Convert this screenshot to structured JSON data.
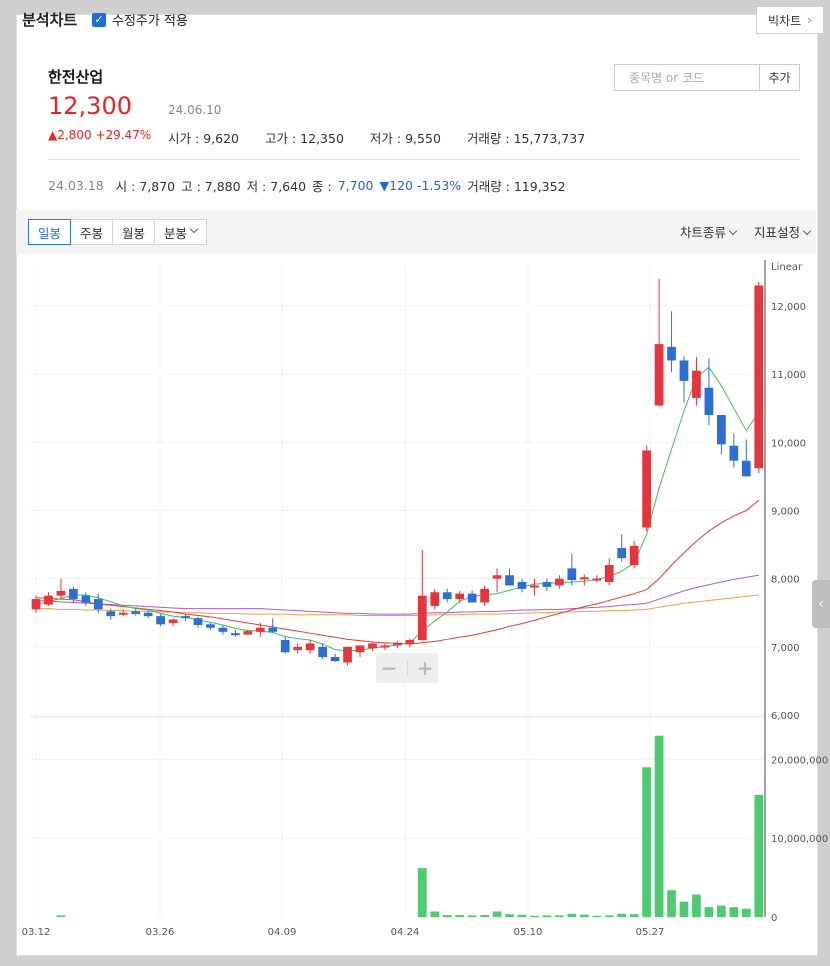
{
  "header": {
    "title": "분석차트",
    "adjusted_label": "수정주가 적용",
    "adjusted_checked": true,
    "big_chart_label": "빅차트"
  },
  "stock": {
    "name": "한전산업",
    "price": "12,300",
    "date": "24.06.10",
    "change": "▲2,800 +29.47%",
    "ohlc": [
      {
        "label": "시가",
        "value": "9,620"
      },
      {
        "label": "고가",
        "value": "12,350"
      },
      {
        "label": "저가",
        "value": "9,550"
      },
      {
        "label": "거래량",
        "value": "15,773,737"
      }
    ]
  },
  "search": {
    "placeholder": "종목명 or 코드",
    "add_label": "추가"
  },
  "previous": {
    "date": "24.03.18",
    "open": "시 : 7,870",
    "high": "고 : 7,880",
    "low": "저 : 7,640",
    "close_label": "종 :",
    "close_value": "7,700",
    "change": "▼120 -1.53%",
    "volume": "거래량 : 119,352"
  },
  "toolbar": {
    "tabs": [
      "일봉",
      "주봉",
      "월봉",
      "분봉"
    ],
    "active_tab": "일봉",
    "chart_type_label": "차트종류",
    "indicator_label": "지표설정"
  },
  "colors": {
    "up": "#e8343c",
    "down": "#2b6fd6",
    "volume": "#4ecb71",
    "ma5": "#3cc060",
    "ma20": "#e0403a",
    "ma60": "#a45de0",
    "ma120": "#f0a040"
  },
  "chart_data": {
    "type": "candlestick",
    "scale_label": "Linear",
    "price_axis": {
      "ylim": [
        6000,
        12600
      ],
      "ticks": [
        "12,000",
        "11,000",
        "10,000",
        "9,000",
        "8,000",
        "7,000",
        "6,000"
      ]
    },
    "volume_axis": {
      "ylim": [
        0,
        25000000
      ],
      "ticks": [
        "20,000,000",
        "10,000,000",
        "0"
      ]
    },
    "x_ticks": [
      "03.12",
      "03.26",
      "04.09",
      "04.24",
      "05.10",
      "05.27"
    ],
    "candles": [
      {
        "o": 7550,
        "h": 7750,
        "l": 7500,
        "c": 7700
      },
      {
        "o": 7620,
        "h": 7800,
        "l": 7600,
        "c": 7750
      },
      {
        "o": 7750,
        "h": 8000,
        "l": 7700,
        "c": 7820
      },
      {
        "o": 7850,
        "h": 7880,
        "l": 7640,
        "c": 7700
      },
      {
        "o": 7750,
        "h": 7800,
        "l": 7600,
        "c": 7650
      },
      {
        "o": 7700,
        "h": 7780,
        "l": 7500,
        "c": 7550
      },
      {
        "o": 7520,
        "h": 7560,
        "l": 7400,
        "c": 7450
      },
      {
        "o": 7480,
        "h": 7550,
        "l": 7450,
        "c": 7500
      },
      {
        "o": 7520,
        "h": 7560,
        "l": 7460,
        "c": 7480
      },
      {
        "o": 7500,
        "h": 7520,
        "l": 7420,
        "c": 7450
      },
      {
        "o": 7450,
        "h": 7480,
        "l": 7300,
        "c": 7330
      },
      {
        "o": 7350,
        "h": 7420,
        "l": 7300,
        "c": 7400
      },
      {
        "o": 7450,
        "h": 7480,
        "l": 7380,
        "c": 7420
      },
      {
        "o": 7420,
        "h": 7440,
        "l": 7280,
        "c": 7320
      },
      {
        "o": 7330,
        "h": 7350,
        "l": 7250,
        "c": 7280
      },
      {
        "o": 7280,
        "h": 7320,
        "l": 7180,
        "c": 7220
      },
      {
        "o": 7200,
        "h": 7250,
        "l": 7150,
        "c": 7180
      },
      {
        "o": 7180,
        "h": 7250,
        "l": 7170,
        "c": 7230
      },
      {
        "o": 7220,
        "h": 7350,
        "l": 7150,
        "c": 7280
      },
      {
        "o": 7280,
        "h": 7420,
        "l": 7200,
        "c": 7220
      },
      {
        "o": 7100,
        "h": 7150,
        "l": 6900,
        "c": 6920
      },
      {
        "o": 6950,
        "h": 7050,
        "l": 6900,
        "c": 7000
      },
      {
        "o": 6950,
        "h": 7100,
        "l": 6900,
        "c": 7050
      },
      {
        "o": 7000,
        "h": 7050,
        "l": 6820,
        "c": 6850
      },
      {
        "o": 6850,
        "h": 6900,
        "l": 6780,
        "c": 6790
      },
      {
        "o": 6770,
        "h": 7000,
        "l": 6730,
        "c": 7000
      },
      {
        "o": 6920,
        "h": 7000,
        "l": 6850,
        "c": 7020
      },
      {
        "o": 6980,
        "h": 7060,
        "l": 6940,
        "c": 7050
      },
      {
        "o": 7000,
        "h": 7050,
        "l": 6950,
        "c": 7020
      },
      {
        "o": 7020,
        "h": 7080,
        "l": 6980,
        "c": 7060
      },
      {
        "o": 7050,
        "h": 7120,
        "l": 7000,
        "c": 7100
      },
      {
        "o": 7100,
        "h": 8420,
        "l": 7080,
        "c": 7750
      },
      {
        "o": 7600,
        "h": 7850,
        "l": 7550,
        "c": 7800
      },
      {
        "o": 7800,
        "h": 7850,
        "l": 7650,
        "c": 7700
      },
      {
        "o": 7700,
        "h": 7820,
        "l": 7650,
        "c": 7780
      },
      {
        "o": 7780,
        "h": 7830,
        "l": 7650,
        "c": 7650
      },
      {
        "o": 7650,
        "h": 7900,
        "l": 7600,
        "c": 7850
      },
      {
        "o": 8000,
        "h": 8150,
        "l": 7800,
        "c": 8050
      },
      {
        "o": 8050,
        "h": 8150,
        "l": 7900,
        "c": 7900
      },
      {
        "o": 7950,
        "h": 8000,
        "l": 7800,
        "c": 7850
      },
      {
        "o": 7900,
        "h": 8000,
        "l": 7750,
        "c": 7900
      },
      {
        "o": 7950,
        "h": 8000,
        "l": 7820,
        "c": 7880
      },
      {
        "o": 7900,
        "h": 8050,
        "l": 7850,
        "c": 8000
      },
      {
        "o": 8150,
        "h": 8360,
        "l": 7900,
        "c": 7980
      },
      {
        "o": 7990,
        "h": 8060,
        "l": 7900,
        "c": 8020
      },
      {
        "o": 7980,
        "h": 8050,
        "l": 7950,
        "c": 8000
      },
      {
        "o": 7950,
        "h": 8300,
        "l": 7900,
        "c": 8200
      },
      {
        "o": 8450,
        "h": 8650,
        "l": 8250,
        "c": 8300
      },
      {
        "o": 8200,
        "h": 8550,
        "l": 8150,
        "c": 8480
      },
      {
        "o": 8750,
        "h": 9950,
        "l": 8700,
        "c": 9880
      },
      {
        "o": 10540,
        "h": 12400,
        "l": 10520,
        "c": 11440
      },
      {
        "o": 11400,
        "h": 11920,
        "l": 11030,
        "c": 11200
      },
      {
        "o": 11200,
        "h": 11260,
        "l": 10580,
        "c": 10900
      },
      {
        "o": 10650,
        "h": 11250,
        "l": 10540,
        "c": 11050
      },
      {
        "o": 10800,
        "h": 11230,
        "l": 10250,
        "c": 10400
      },
      {
        "o": 10400,
        "h": 10400,
        "l": 9820,
        "c": 9970
      },
      {
        "o": 9950,
        "h": 10130,
        "l": 9630,
        "c": 9730
      },
      {
        "o": 9730,
        "h": 10040,
        "l": 9500,
        "c": 9500
      },
      {
        "o": 9620,
        "h": 12350,
        "l": 9550,
        "c": 12300
      }
    ],
    "volume": [
      0,
      0,
      200000,
      0,
      0,
      0,
      0,
      0,
      0,
      0,
      0,
      0,
      0,
      0,
      0,
      0,
      0,
      0,
      0,
      0,
      0,
      0,
      0,
      0,
      0,
      0,
      0,
      0,
      0,
      0,
      0,
      6200000,
      700000,
      250000,
      250000,
      200000,
      250000,
      700000,
      350000,
      300000,
      150000,
      200000,
      200000,
      400000,
      300000,
      150000,
      200000,
      400000,
      350000,
      19000000,
      23000000,
      3400000,
      1950000,
      2850000,
      1250000,
      1450000,
      1250000,
      1050000,
      15500000
    ],
    "ma5": [
      7620,
      7660,
      7710,
      7760,
      7760,
      7720,
      7660,
      7600,
      7560,
      7540,
      7490,
      7450,
      7430,
      7400,
      7360,
      7320,
      7270,
      7240,
      7230,
      7210,
      7150,
      7120,
      7100,
      7040,
      6960,
      6940,
      6950,
      6980,
      7000,
      7030,
      7060,
      7230,
      7380,
      7510,
      7670,
      7740,
      7760,
      7780,
      7830,
      7880,
      7920,
      7930,
      7940,
      7950,
      7960,
      7990,
      8030,
      8110,
      8230,
      8650,
      9330,
      9900,
      10460,
      10950,
      11100,
      10830,
      10500,
      10170,
      10440
    ],
    "ma20": [
      7720,
      7710,
      7700,
      7690,
      7660,
      7630,
      7610,
      7590,
      7570,
      7550,
      7530,
      7510,
      7480,
      7460,
      7440,
      7410,
      7380,
      7350,
      7320,
      7290,
      7260,
      7230,
      7200,
      7170,
      7140,
      7110,
      7090,
      7070,
      7060,
      7050,
      7040,
      7060,
      7080,
      7110,
      7140,
      7170,
      7210,
      7250,
      7300,
      7340,
      7390,
      7440,
      7490,
      7540,
      7590,
      7630,
      7680,
      7730,
      7780,
      7840,
      8000,
      8200,
      8380,
      8550,
      8700,
      8820,
      8920,
      9000,
      9150
    ],
    "ma60": [
      7680,
      7670,
      7660,
      7650,
      7640,
      7630,
      7620,
      7610,
      7600,
      7590,
      7580,
      7570,
      7560,
      7560,
      7560,
      7560,
      7560,
      7560,
      7560,
      7550,
      7540,
      7530,
      7520,
      7510,
      7500,
      7490,
      7490,
      7480,
      7480,
      7480,
      7480,
      7490,
      7500,
      7500,
      7510,
      7510,
      7520,
      7520,
      7530,
      7540,
      7540,
      7550,
      7550,
      7560,
      7570,
      7580,
      7590,
      7610,
      7620,
      7640,
      7700,
      7760,
      7820,
      7870,
      7910,
      7950,
      7990,
      8020,
      8050
    ],
    "ma120": [
      7560,
      7560,
      7550,
      7550,
      7540,
      7540,
      7530,
      7530,
      7520,
      7520,
      7510,
      7510,
      7500,
      7500,
      7490,
      7490,
      7490,
      7480,
      7480,
      7480,
      7480,
      7470,
      7470,
      7470,
      7470,
      7470,
      7460,
      7460,
      7460,
      7460,
      7460,
      7460,
      7470,
      7470,
      7470,
      7480,
      7480,
      7480,
      7490,
      7490,
      7500,
      7500,
      7510,
      7510,
      7520,
      7520,
      7530,
      7530,
      7540,
      7550,
      7580,
      7610,
      7640,
      7660,
      7680,
      7700,
      7720,
      7740,
      7760
    ]
  }
}
